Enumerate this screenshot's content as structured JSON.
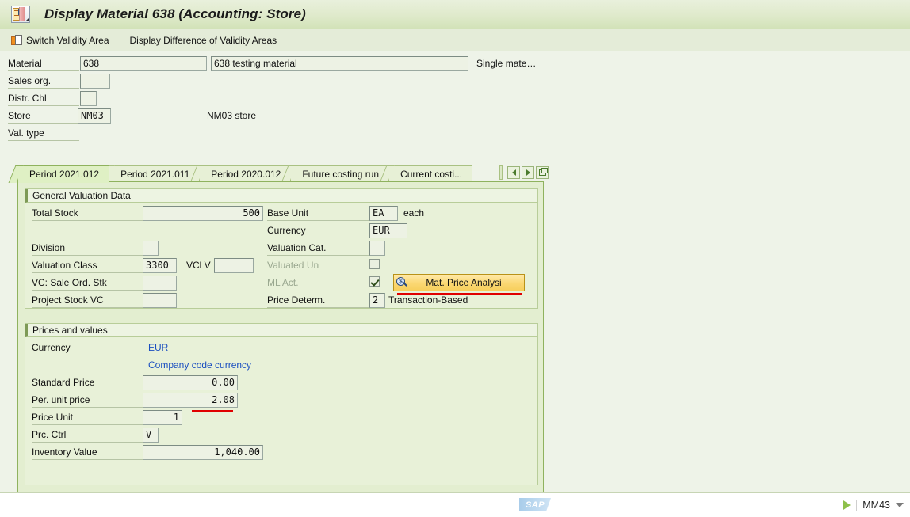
{
  "window": {
    "title": "Display Material 638 (Accounting: Store)",
    "icon": "sap-material-icon"
  },
  "toolbar": {
    "switch_validity_label": "Switch Validity Area",
    "display_difference_label": "Display Difference of Validity Areas"
  },
  "header": {
    "rows": [
      {
        "label": "Material",
        "value": "638",
        "desc": "638 testing material",
        "extra": "Single mate…"
      },
      {
        "label": "Sales org.",
        "value": "",
        "desc": "",
        "extra": ""
      },
      {
        "label": "Distr. Chl",
        "value": "",
        "desc": "",
        "extra": ""
      },
      {
        "label": "Store",
        "value": "NM03",
        "desc": "NM03 store",
        "extra": ""
      },
      {
        "label": "Val. type",
        "value": "",
        "desc": "",
        "extra": ""
      }
    ]
  },
  "tabs": {
    "items": [
      {
        "label": "Period 2021.012",
        "active": true
      },
      {
        "label": "Period 2021.011",
        "active": false
      },
      {
        "label": "Period 2020.012",
        "active": false
      },
      {
        "label": "Future costing run",
        "active": false
      },
      {
        "label": "Current costi...",
        "active": false
      }
    ],
    "nav": {
      "prev": "scroll-left",
      "next": "scroll-right",
      "list": "tab-list"
    }
  },
  "general_valuation": {
    "title": "General Valuation Data",
    "total_stock_label": "Total Stock",
    "total_stock_value": "500",
    "base_unit_label": "Base Unit",
    "base_unit_value": "EA",
    "base_unit_text": "each",
    "currency_label": "Currency",
    "currency_value": "EUR",
    "division_label": "Division",
    "division_value": "",
    "valuation_cat_label": "Valuation Cat.",
    "valuation_cat_value": "",
    "valuation_class_label": "Valuation Class",
    "valuation_class_value": "3300",
    "vcl_v_label": "VCl V",
    "vcl_v_value": "",
    "valuated_un_label": "Valuated Un",
    "valuated_un_checked": false,
    "vc_sale_ord_label": "VC: Sale Ord. Stk",
    "vc_sale_ord_value": "",
    "ml_act_label": "ML Act.",
    "ml_act_checked": true,
    "mat_price_button": "Mat. Price Analysi",
    "project_stock_label": "Project Stock VC",
    "project_stock_value": "",
    "price_determ_label": "Price Determ.",
    "price_determ_value": "2",
    "price_determ_text": "Transaction-Based"
  },
  "prices_and_values": {
    "title": "Prices and values",
    "currency_label": "Currency",
    "currency_value": "EUR",
    "company_code_currency": "Company code currency",
    "standard_price_label": "Standard Price",
    "standard_price_value": "0.00",
    "per_unit_price_label": "Per. unit price",
    "per_unit_price_value": "2.08",
    "price_unit_label": "Price Unit",
    "price_unit_value": "1",
    "prc_ctrl_label": "Prc. Ctrl",
    "prc_ctrl_value": "V",
    "inventory_value_label": "Inventory Value",
    "inventory_value_value": "1,040.00"
  },
  "statusbar": {
    "logo": "SAP",
    "transaction": "MM43"
  },
  "colors": {
    "page_bg": "#eef3e8",
    "panel_bg": "#e3eed0",
    "group_bg": "#e8f1d8",
    "field_bg": "#edf2e4",
    "accent_border": "#8fb25e",
    "link": "#1b4fc0",
    "gold_button": "#fbd873",
    "annotation_red": "#e00000"
  }
}
